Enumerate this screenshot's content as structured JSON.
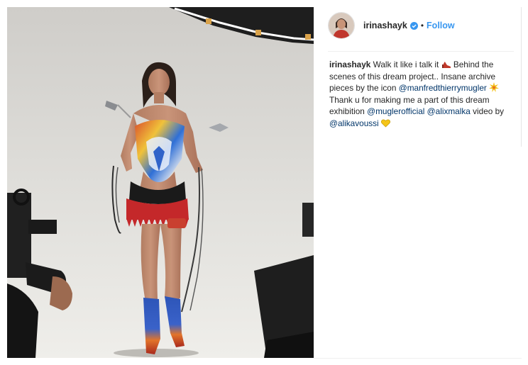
{
  "post": {
    "username": "irinashayk",
    "dot": "•",
    "follow_label": "Follow",
    "verified_icon": "verified-badge-icon",
    "colors": {
      "follow": "#3897f0",
      "mention": "#003569",
      "verified": "#3897f0",
      "text": "#262626"
    }
  },
  "caption": {
    "username": "irinashayk",
    "text_1": "Walk it like i talk it",
    "emoji_1": "high-heel-shoe-icon",
    "text_2": "Behind the scenes of this dream project.. Insane archive pieces by the icon",
    "mention_1": "@manfredthierrymugler",
    "emoji_2": "sparkle-burst-icon",
    "text_3": "Thank u for making me a part of this dream exhibition",
    "mention_2": "@muglerofficial",
    "mention_3": "@alixmalka",
    "text_4": "video by",
    "mention_4": "@alikavoussi",
    "emoji_3": "yellow-heart-icon"
  }
}
